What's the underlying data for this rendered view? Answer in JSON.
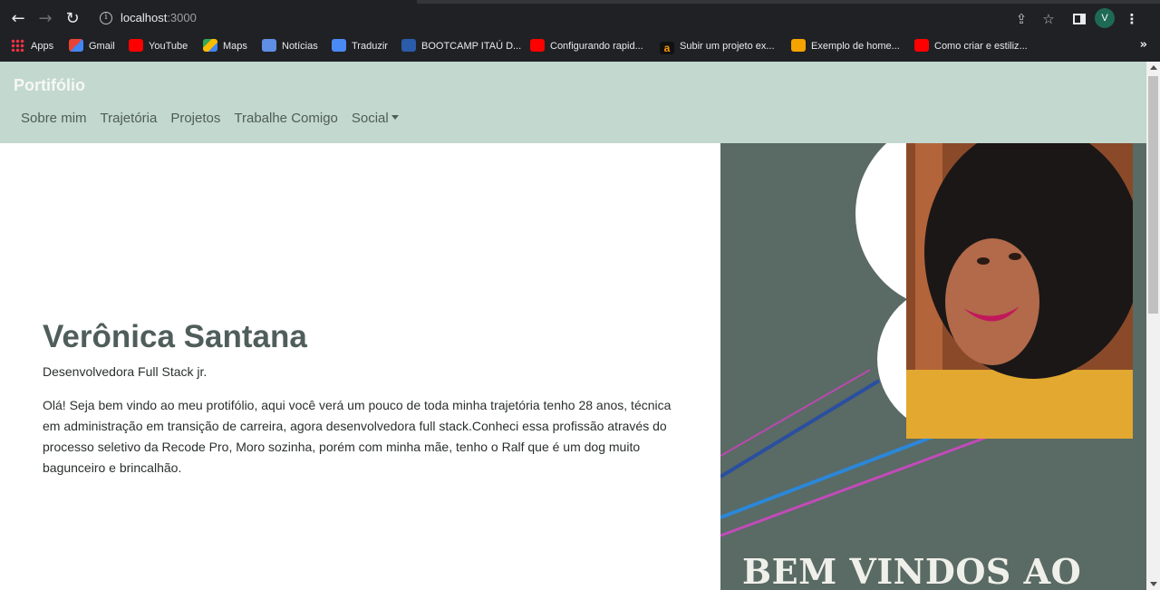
{
  "browser": {
    "url_host": "localhost",
    "url_port": ":3000",
    "profile_initial": "V",
    "bookmarks": [
      {
        "label": "Apps",
        "icon": "apps-grid-icon"
      },
      {
        "label": "Gmail",
        "icon": "gmail-icon"
      },
      {
        "label": "YouTube",
        "icon": "youtube-icon"
      },
      {
        "label": "Maps",
        "icon": "maps-icon"
      },
      {
        "label": "Notícias",
        "icon": "news-icon"
      },
      {
        "label": "Traduzir",
        "icon": "translate-icon"
      },
      {
        "label": "BOOTCAMP ITAÚ D...",
        "icon": "dio-icon"
      },
      {
        "label": "Configurando rapid...",
        "icon": "youtube-icon"
      },
      {
        "label": "Subir um projeto ex...",
        "icon": "amazon-icon"
      },
      {
        "label": "Exemplo de home...",
        "icon": "page-icon"
      },
      {
        "label": "Como criar e estiliz...",
        "icon": "youtube-icon"
      }
    ],
    "more_label": "»"
  },
  "navbar": {
    "brand": "Portifólio",
    "links": [
      "Sobre mim",
      "Trajetória",
      "Projetos",
      "Trabalhe Comigo",
      "Social"
    ]
  },
  "hero": {
    "name": "Verônica Santana",
    "role": "Desenvolvedora Full Stack jr.",
    "bio": "Olá! Seja bem vindo ao meu protifólio, aqui você verá um pouco de toda minha trajetória tenho 28 anos, técnica em administração em transição de carreira, agora desenvolvedora full stack.Conheci essa profissão através do processo seletivo da Recode Pro, Moro sozinha, porém com minha mãe, tenho o Ralf que é um dog muito bagunceiro e brincalhão.",
    "banner_text": "BEM VINDOS  AO"
  },
  "colors": {
    "navbar_bg": "#c3d8cf",
    "banner_bg": "#5a6a64",
    "name_color": "#4f5e5b"
  }
}
